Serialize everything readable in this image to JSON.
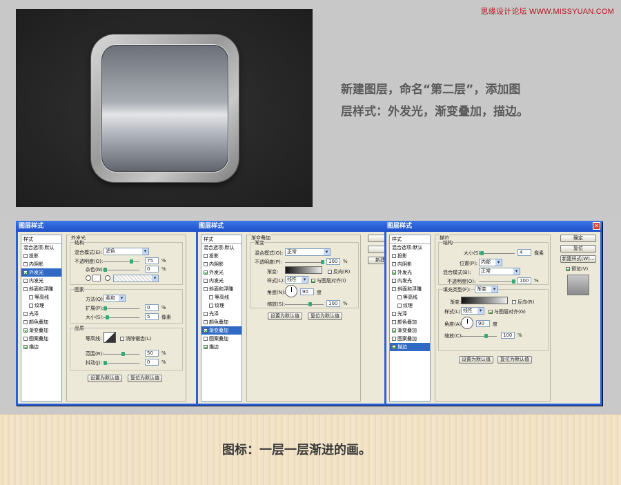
{
  "watermark": "思缘设计论坛 WWW.MISSYUAN.COM",
  "description": {
    "line1": "新建图层，命名“第二层”，添加图",
    "line2": "层样式：外发光，渐变叠加，描边。"
  },
  "caption": "图标：一层一层渐进的画。",
  "style_list_items": [
    "投影",
    "内阴影",
    "外发光",
    "内发光",
    "斜面和浮雕",
    "等高线",
    "纹理",
    "光泽",
    "颜色叠加",
    "渐变叠加",
    "图案叠加",
    "描边"
  ],
  "dialog1": {
    "title": "图层样式",
    "styles_header": "样式",
    "blend_default": "混合选项:默认",
    "checked": [
      false,
      false,
      true,
      false,
      false,
      false,
      false,
      false,
      false,
      true,
      false,
      true
    ],
    "selected_index": 2,
    "section": "外发光",
    "structure": "结构",
    "blend_mode_label": "混合模式(E):",
    "blend_mode": "滤色",
    "opacity_label": "不透明度(O):",
    "opacity": "75",
    "noise_label": "杂色(N):",
    "noise": "0",
    "pct": "%",
    "elements": "图素",
    "method_label": "方法(Q):",
    "method": "柔和",
    "spread_label": "扩展(P):",
    "spread": "0",
    "size_label": "大小(S):",
    "size": "5",
    "px": "像素",
    "quality": "品质",
    "contour_label": "等高线:",
    "antialias": "消除锯齿(L)",
    "range_label": "范围(R):",
    "range": "50",
    "jitter_label": "抖动(J):",
    "jitter": "0",
    "make_default": "设置为默认值",
    "reset_default": "复位为默认值"
  },
  "dialog2": {
    "title": "图层样式",
    "styles_header": "样式",
    "blend_default": "混合选项:默认",
    "checked": [
      false,
      false,
      true,
      false,
      false,
      false,
      false,
      false,
      false,
      true,
      false,
      true
    ],
    "selected_index": 9,
    "section": "渐变叠加",
    "gradient_group": "渐变",
    "blend_mode_label": "混合模式(O):",
    "blend_mode": "正常",
    "opacity_label": "不透明度(P):",
    "opacity": "100",
    "gradient_label": "渐变:",
    "reverse": "反向(R)",
    "style_label": "样式(L):",
    "style": "线性",
    "align": "与图层对齐(I)",
    "angle_label": "角度(N):",
    "angle": "90",
    "degree": "度",
    "scale_label": "缩放(S):",
    "scale": "100",
    "pct": "%",
    "make_default": "设置为默认值",
    "reset_default": "复位为默认值",
    "side_btn": "新建"
  },
  "dialog3": {
    "title": "图层样式",
    "styles_header": "样式",
    "blend_default": "混合选项:默认",
    "checked": [
      false,
      false,
      true,
      false,
      false,
      false,
      false,
      false,
      false,
      true,
      false,
      true
    ],
    "selected_index": 11,
    "section": "描边",
    "structure": "结构",
    "size_label": "大小(S):",
    "size": "4",
    "px": "像素",
    "position_label": "位置(P):",
    "position": "内部",
    "blend_mode_label": "混合模式(B):",
    "blend_mode": "正常",
    "opacity_label": "不透明度(O):",
    "opacity": "100",
    "pct": "%",
    "fill_type_label": "填充类型(F):",
    "fill_type": "渐变",
    "gradient_label": "渐变:",
    "reverse": "反向(R)",
    "style_label": "样式(L):",
    "style": "线性",
    "align": "与图层对齐(G)",
    "angle_label": "角度(A):",
    "angle": "90",
    "degree": "度",
    "scale_label": "缩放(C):",
    "scale": "100",
    "make_default": "设置为默认值",
    "reset_default": "复位为默认值",
    "ok": "确定",
    "cancel": "复位",
    "new_style": "新建样式(W)...",
    "preview": "预览(V)"
  }
}
